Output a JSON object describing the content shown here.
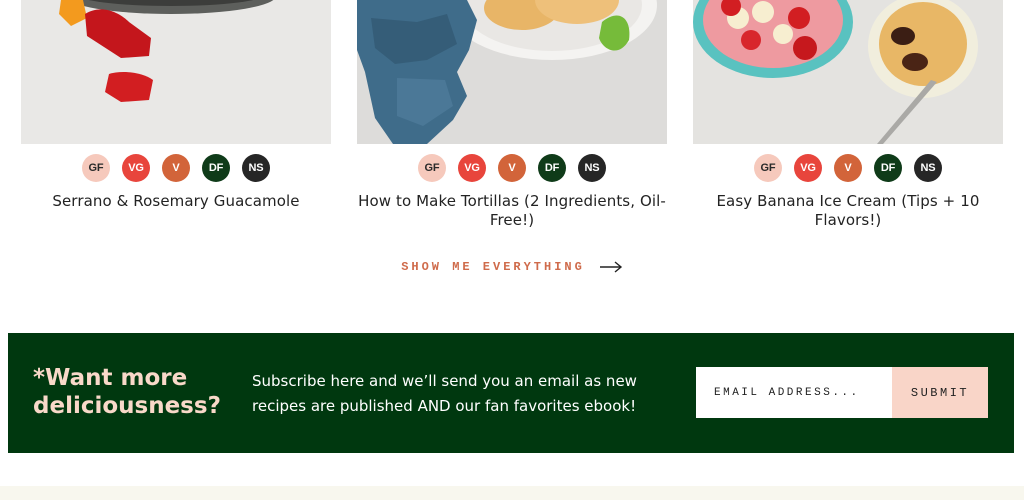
{
  "cards": [
    {
      "title": "Serrano & Rosemary Guacamole",
      "image": "guacamole-photo",
      "badges": [
        "GF",
        "VG",
        "V",
        "DF",
        "NS"
      ]
    },
    {
      "title": "How to Make Tortillas (2 Ingredients, Oil-Free!)",
      "image": "tortillas-photo",
      "badges": [
        "GF",
        "VG",
        "V",
        "DF",
        "NS"
      ]
    },
    {
      "title": "Easy Banana Ice Cream (Tips + 10 Flavors!)",
      "image": "banana-ice-cream-photo",
      "badges": [
        "GF",
        "VG",
        "V",
        "DF",
        "NS"
      ]
    }
  ],
  "show_all": {
    "label": "SHOW ME EVERYTHING",
    "icon": "arrow-right-icon"
  },
  "newsletter": {
    "heading": "*Want more deliciousness?",
    "text": "Subscribe here and we’ll send you an email as new recipes are published AND our fan favorites ebook!",
    "email_placeholder": "EMAIL ADDRESS...",
    "submit_label": "SUBMIT"
  },
  "colors": {
    "brand_green": "#00380f",
    "accent_peach": "#f9d5c8",
    "link_orange": "#cf6b4b",
    "badge_gf": "#f6c9bc",
    "badge_vg": "#e8453c",
    "badge_v": "#d2643a",
    "badge_df": "#0f3b19",
    "badge_ns": "#262626"
  }
}
